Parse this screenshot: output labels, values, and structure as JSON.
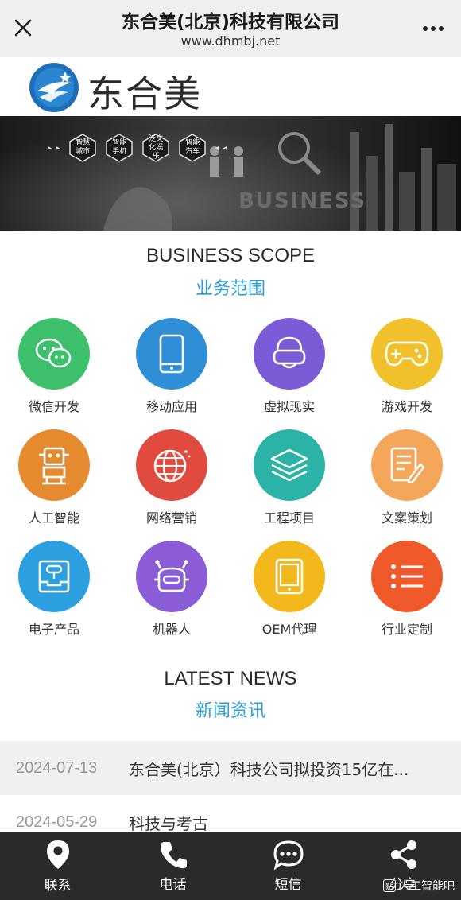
{
  "topbar": {
    "title": "东合美(北京)科技有限公司",
    "url": "www.dhmbj.net",
    "close_icon": "close-icon",
    "more_icon": "more-icon"
  },
  "logo": {
    "text": "东合美"
  },
  "banner": {
    "hexagons": [
      "智慧城市",
      "智能手机",
      "泛文化娱乐",
      "智能汽车"
    ],
    "arrows_left": "▸ ▸",
    "arrows_right": "◂ ◂",
    "business_text": "BUSINESS"
  },
  "business_scope": {
    "title_en": "BUSINESS SCOPE",
    "title_cn": "业务范围",
    "items": [
      {
        "label": "微信开发",
        "color": "#3cc06b",
        "icon": "wechat-icon"
      },
      {
        "label": "移动应用",
        "color": "#2e8fd6",
        "icon": "mobile-icon"
      },
      {
        "label": "虚拟现实",
        "color": "#7b5bd6",
        "icon": "vr-headset-icon"
      },
      {
        "label": "游戏开发",
        "color": "#f0c12a",
        "icon": "gamepad-icon"
      },
      {
        "label": "人工智能",
        "color": "#e58a2e",
        "icon": "robot-icon"
      },
      {
        "label": "网络营销",
        "color": "#e04a3f",
        "icon": "globe-icon"
      },
      {
        "label": "工程项目",
        "color": "#2cb3a8",
        "icon": "layers-icon"
      },
      {
        "label": "文案策划",
        "color": "#f4a65a",
        "icon": "document-edit-icon"
      },
      {
        "label": "电子产品",
        "color": "#2b9fe0",
        "icon": "device-icon"
      },
      {
        "label": "机器人",
        "color": "#8a5cd6",
        "icon": "robot-head-icon"
      },
      {
        "label": "OEM代理",
        "color": "#f3b81c",
        "icon": "tablet-icon"
      },
      {
        "label": "行业定制",
        "color": "#f05a2a",
        "icon": "list-icon"
      }
    ]
  },
  "latest_news": {
    "title_en": "LATEST NEWS",
    "title_cn": "新闻资讯",
    "items": [
      {
        "date": "2024-07-13",
        "headline": "东合美(北京）科技公司拟投资15亿在..."
      },
      {
        "date": "2024-05-29",
        "headline": "科技与考古"
      }
    ]
  },
  "bottombar": {
    "items": [
      {
        "label": "联系",
        "icon": "location-pin-icon"
      },
      {
        "label": "电话",
        "icon": "phone-icon"
      },
      {
        "label": "短信",
        "icon": "message-icon"
      },
      {
        "label": "分享",
        "icon": "share-icon"
      }
    ]
  },
  "watermark": {
    "text": "人工智能吧",
    "badge": "贴"
  }
}
